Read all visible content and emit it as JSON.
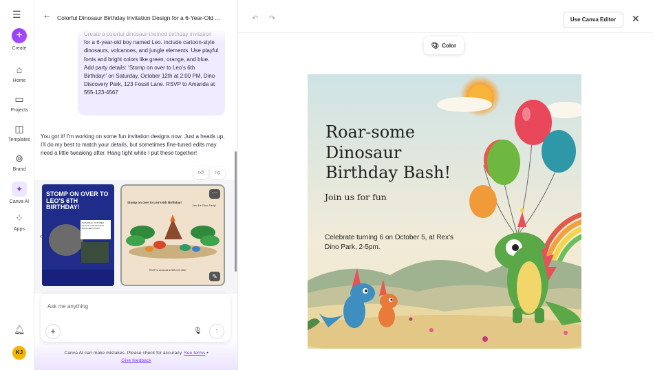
{
  "rail": {
    "create": "Create",
    "home": "Home",
    "projects": "Projects",
    "templates": "Templates",
    "brand": "Brand",
    "canva_ai": "Canva AI",
    "apps": "Apps",
    "avatar_initials": "KJ"
  },
  "chat": {
    "title": "Colorful Dinosaur Birthday Invitation Design for a 6-Year-Old ...",
    "user_prompt": "Create a colorful dinosaur-themed birthday invitation for a 6-year-old boy named Leo. Include cartoon-style dinosaurs, volcanoes, and jungle elements. Use playful fonts and bright colors like green, orange, and blue. Add party details: ‘Stomp on over to Leo’s 6th Birthday!’ on Saturday, October 12th at 2:00 PM, Dino Discovery Park, 123 Fossil Lane. RSVP to Amanda at 555-123-4567",
    "ai_reply": "You got it! I’m working on some fun invitation designs now. Just a heads up, I’ll do my best to match your details, but sometimes fine-tuned edits may need a little tweaking after. Hang tight while I put these together!",
    "card1_title": "STOMP ON OVER TO LEO'S 6TH BIRTHDAY!",
    "card1_info": "SATURDAY, OCTOBER 12TH AT 2:00 PM DINO DISCOVERY PARK",
    "card2_title": "Stomp on over to Leo's 6th Birthday!",
    "card2_join": "Join the Dino Party!",
    "card2_rsvp": "RSVP to Amanda at 555-123-4567",
    "composer_placeholder": "Ask me anything",
    "disclaimer": "Canva AI can make mistakes. Please check for accuracy.",
    "see_terms": "See terms",
    "give_feedback": "Give feedback"
  },
  "toolbar": {
    "use_editor": "Use Canva Editor",
    "color": "Color"
  },
  "design": {
    "title_lines": [
      "Roar-some",
      "Dinosaur",
      "Birthday Bash!"
    ],
    "join": "Join us for fun",
    "details": "Celebrate turning 6 on October 5, at Rex's Dino Park, 2-5pm."
  },
  "colors": {
    "accent": "#8b3dff",
    "ai_bubble": "#f1ebff",
    "card_blue": "#1f2c8a"
  }
}
